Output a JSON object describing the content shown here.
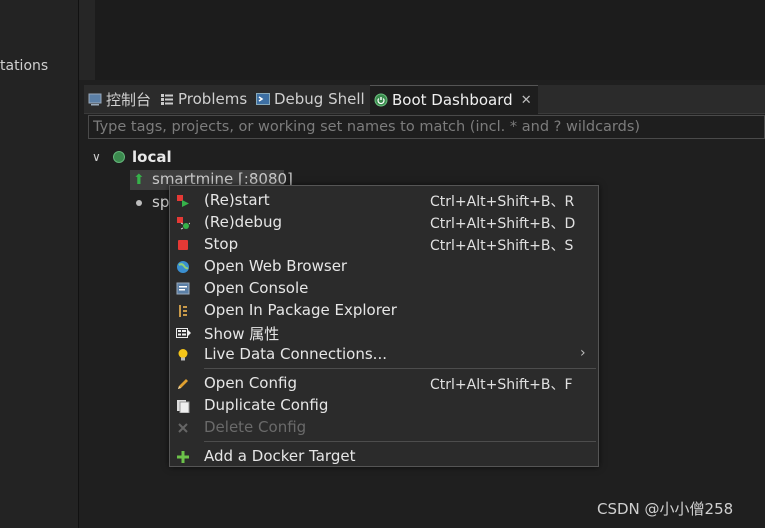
{
  "left_panel": {
    "text": "tations"
  },
  "tabs": [
    {
      "label": "控制台",
      "icon": "console-icon"
    },
    {
      "label": "Problems",
      "icon": "problems-icon"
    },
    {
      "label": "Debug Shell",
      "icon": "debug-shell-icon"
    },
    {
      "label": "Boot Dashboard",
      "icon": "spring-boot-icon",
      "active": true
    }
  ],
  "filter": {
    "placeholder": "Type tags, projects, or working set names to match (incl. * and ? wildcards)",
    "value": ""
  },
  "tree": {
    "root_label": "local",
    "app1_label": "smartmine [:8080]",
    "app2_label": "sp"
  },
  "context_menu": {
    "items": [
      {
        "label": "(Re)start",
        "shortcut": "Ctrl+Alt+Shift+B、R",
        "icon": "restart-icon"
      },
      {
        "label": "(Re)debug",
        "shortcut": "Ctrl+Alt+Shift+B、D",
        "icon": "debug-icon"
      },
      {
        "label": "Stop",
        "shortcut": "Ctrl+Alt+Shift+B、S",
        "icon": "stop-icon"
      },
      {
        "label": "Open Web Browser",
        "shortcut": "",
        "icon": "globe-icon"
      },
      {
        "label": "Open Console",
        "shortcut": "",
        "icon": "console-icon"
      },
      {
        "label": "Open In Package Explorer",
        "shortcut": "",
        "icon": "package-explorer-icon"
      },
      {
        "label": "Show 属性",
        "shortcut": "",
        "icon": "properties-icon"
      },
      {
        "label": "Live Data Connections...",
        "shortcut": "",
        "icon": "lightbulb-icon",
        "submenu": true
      },
      {
        "label": "Open Config",
        "shortcut": "Ctrl+Alt+Shift+B、F",
        "icon": "pencil-icon"
      },
      {
        "label": "Duplicate Config",
        "shortcut": "",
        "icon": "duplicate-icon"
      },
      {
        "label": "Delete Config",
        "shortcut": "",
        "icon": "delete-icon",
        "disabled": true
      },
      {
        "label": "Add a Docker Target",
        "shortcut": "",
        "icon": "plus-icon"
      }
    ],
    "submenu_arrow": "›"
  },
  "watermark": "CSDN @小小僧258",
  "colors": {
    "background": "#1f1f1f",
    "menu_bg": "#2b2b2b",
    "accent_green": "#36b24a",
    "stop_red": "#e53935"
  }
}
